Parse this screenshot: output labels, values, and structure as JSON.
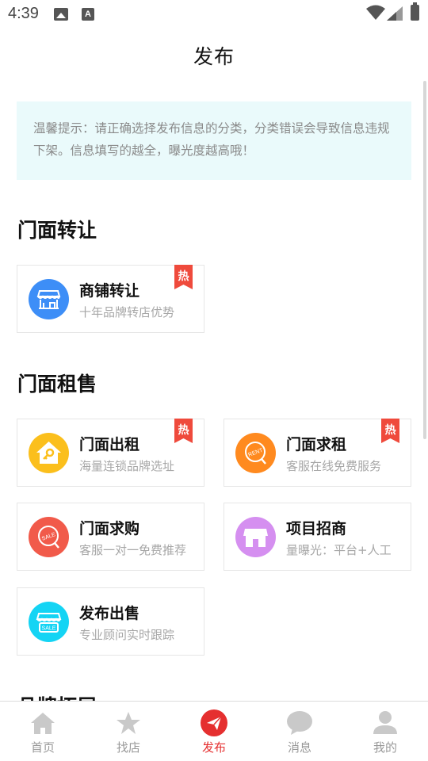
{
  "status_bar": {
    "time": "4:39",
    "notification_icons": [
      "gallery-icon",
      "a-icon"
    ],
    "system_icons": [
      "wifi-icon",
      "signal-icon",
      "battery-icon"
    ]
  },
  "header": {
    "title": "发布"
  },
  "tip": {
    "text": "温馨提示：请正确选择发布信息的分类，分类错误会导致信息违规下架。信息填写的越全，曝光度越高哦！"
  },
  "sections": [
    {
      "title": "门面转让",
      "cards": [
        {
          "name": "商铺转让",
          "desc": "十年品牌转店优势",
          "hot": true,
          "icon": "storefront-icon",
          "color": "#3d8ef7"
        }
      ]
    },
    {
      "title": "门面租售",
      "cards": [
        {
          "name": "门面出租",
          "desc": "海量连锁品牌选址",
          "hot": true,
          "icon": "house-key-icon",
          "color": "#fbbf1c"
        },
        {
          "name": "门面求租",
          "desc": "客服在线免费服务",
          "hot": true,
          "icon": "rent-tag-icon",
          "color": "#ff8a1f"
        },
        {
          "name": "门面求购",
          "desc": "客服一对一免费推荐",
          "hot": false,
          "icon": "sale-tag-icon",
          "color": "#f15a4a"
        },
        {
          "name": "项目招商",
          "desc": "量曝光：平台+人工",
          "hot": false,
          "icon": "shop-icon",
          "color": "#d58ff0"
        },
        {
          "name": "发布出售",
          "desc": "专业顾问实时跟踪",
          "hot": false,
          "icon": "sale-shop-icon",
          "color": "#14d4f4"
        }
      ]
    },
    {
      "title": "品牌拓展"
    }
  ],
  "hot_label": "热",
  "icon_text": {
    "rent": "RENT",
    "sale": "SALE"
  },
  "tabbar": {
    "items": [
      {
        "label": "首页",
        "icon": "home-icon",
        "active": false
      },
      {
        "label": "找店",
        "icon": "star-icon",
        "active": false
      },
      {
        "label": "发布",
        "icon": "send-icon",
        "active": true
      },
      {
        "label": "消息",
        "icon": "message-icon",
        "active": false
      },
      {
        "label": "我的",
        "icon": "person-icon",
        "active": false
      }
    ]
  },
  "colors": {
    "accent": "#e52f2f",
    "tip_background": "#eafafb",
    "hot_badge": "#ef4a3c"
  }
}
